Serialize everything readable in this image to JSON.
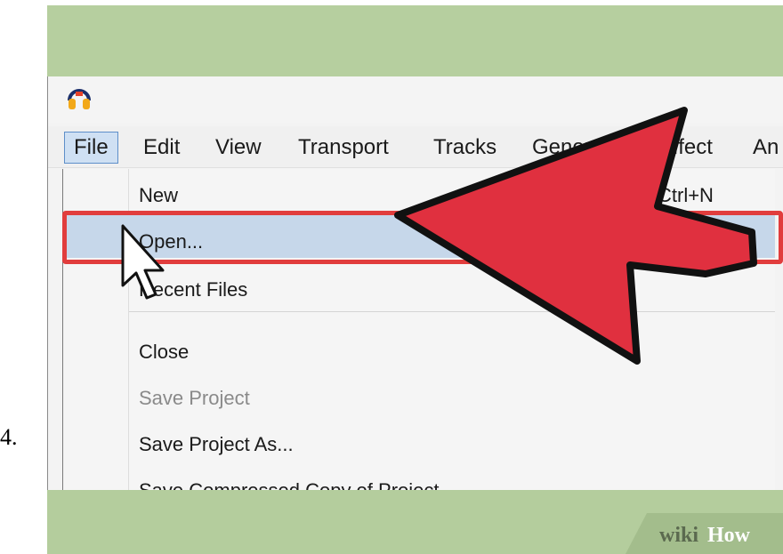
{
  "step": {
    "number": "4."
  },
  "menubar": {
    "items": [
      "File",
      "Edit",
      "View",
      "Transport",
      "Tracks",
      "Generate",
      "Effect",
      "An"
    ]
  },
  "file_menu": {
    "items": [
      {
        "label": "New",
        "shortcut": "Ctrl+N",
        "enabled": true
      },
      {
        "label": "Open...",
        "shortcut": "",
        "enabled": true
      },
      {
        "label": "Recent Files",
        "shortcut": "",
        "enabled": true
      },
      {
        "label": "Close",
        "shortcut": "",
        "enabled": true
      },
      {
        "label": "Save Project",
        "shortcut": "",
        "enabled": false
      },
      {
        "label": "Save Project As...",
        "shortcut": "",
        "enabled": true
      },
      {
        "label": "Save Compressed Copy of Project...",
        "shortcut": "",
        "enabled": true
      }
    ]
  },
  "watermark": {
    "wiki": "wiki",
    "how": "How"
  },
  "colors": {
    "arrow": "#e0303f",
    "highlight_border": "#e13d3d",
    "background_green": "#b4cd9d",
    "menu_highlight": "#c6d7ea"
  }
}
